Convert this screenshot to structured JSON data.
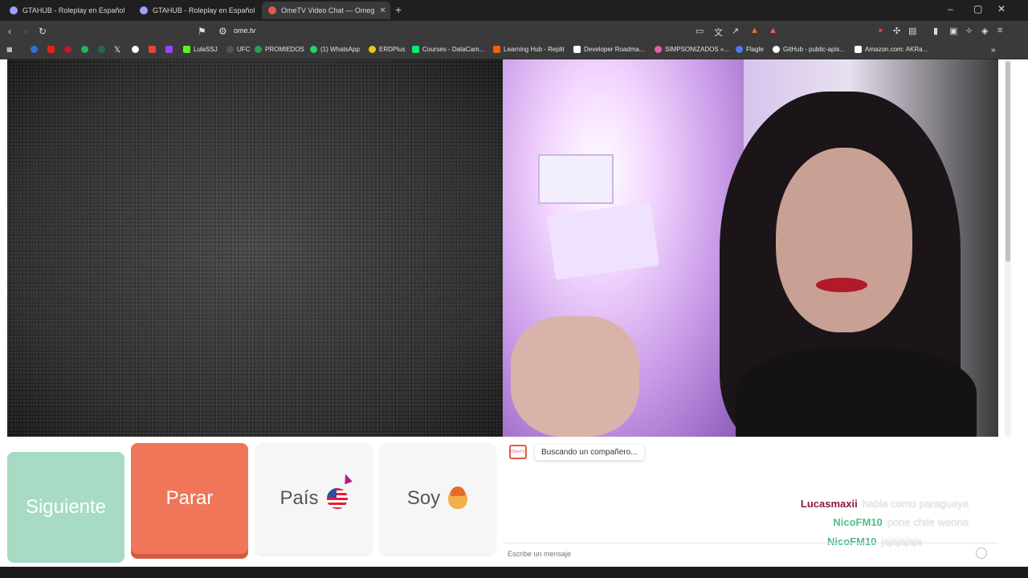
{
  "tabs": [
    {
      "title": "GTAHUB - Roleplay en Español",
      "active": false
    },
    {
      "title": "GTAHUB - Roleplay en Español",
      "active": false
    },
    {
      "title": "OmeTV Video Chat — Omeg",
      "active": true
    }
  ],
  "window_controls": {
    "minimize": "–",
    "maximize": "▢",
    "close": "✕"
  },
  "address_bar": {
    "url": "ome.tv"
  },
  "bookmarks": [
    {
      "label": "",
      "icon": "blue-dot",
      "color": "#2f6fe0"
    },
    {
      "label": "",
      "icon": "youtube-icon",
      "color": "#e62117"
    },
    {
      "label": "",
      "icon": "red-dot",
      "color": "#c0172a"
    },
    {
      "label": "",
      "icon": "green-dot",
      "color": "#1db954"
    },
    {
      "label": "",
      "icon": "teal-dot",
      "color": "#1e6b5a"
    },
    {
      "label": "",
      "icon": "gmail-icon",
      "color": "#ea4335"
    },
    {
      "label": "",
      "icon": "x-icon",
      "color": "#ffffff"
    },
    {
      "label": "",
      "icon": "white-dot",
      "color": "#ffffff"
    },
    {
      "label": "",
      "icon": "twitch-icon",
      "color": "#9146ff"
    },
    {
      "label": "LulaSSJ",
      "icon": "kick-icon",
      "color": "#53fc18"
    },
    {
      "label": "UFC",
      "icon": "ufc-icon",
      "color": "#555555"
    },
    {
      "label": "PROMIEDOS",
      "icon": "promiedos-icon",
      "color": "#2e9d4a"
    },
    {
      "label": "(1) WhatsApp",
      "icon": "whatsapp-icon",
      "color": "#25d366"
    },
    {
      "label": "ERDPlus",
      "icon": "erd-icon",
      "color": "#f0c419"
    },
    {
      "label": "Courses - DataCam...",
      "icon": "datacamp-icon",
      "color": "#03ef62"
    },
    {
      "label": "Learning Hub - Replit",
      "icon": "replit-icon",
      "color": "#f26207"
    },
    {
      "label": "Developer Roadma...",
      "icon": "roadmap-icon",
      "color": "#ffffff"
    },
    {
      "label": "SIMPSONIZADOS »...",
      "icon": "simpson-icon",
      "color": "#e65fa4"
    },
    {
      "label": "Flagle",
      "icon": "flagle-icon",
      "color": "#4b7bec"
    },
    {
      "label": "GitHub - public-apis...",
      "icon": "github-icon",
      "color": "#ffffff"
    },
    {
      "label": "Amazon.com: AKRa...",
      "icon": "amazon-icon",
      "color": "#ffffff"
    }
  ],
  "buttons": {
    "next": "Siguiente",
    "stop": "Parar",
    "country": "País",
    "iam": "Soy"
  },
  "chat": {
    "logo": "OmeTV",
    "status": "Buscando un compañero...",
    "placeholder": "Escribe un mensaje",
    "overlay_messages": [
      {
        "user": "Lucasmaxii",
        "text": "habla como paraguaya",
        "color": "#8b1a3a"
      },
      {
        "user": "NicoFM10",
        "text": "pone chile weona",
        "color": "#4fc08d"
      },
      {
        "user": "NicoFM10",
        "text": "jajajajaja",
        "color": "#4fc08d"
      }
    ]
  },
  "colors": {
    "next": "#a7dbc3",
    "stop": "#ef7659",
    "neutral": "#f6f6f6"
  }
}
